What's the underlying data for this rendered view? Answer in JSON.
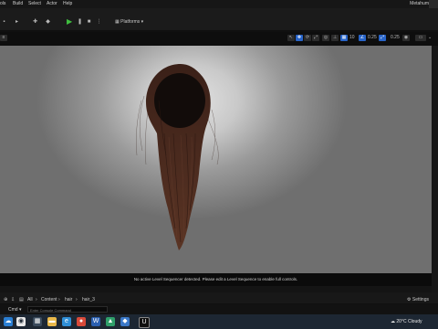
{
  "menu": [
    "ols",
    "Build",
    "Select",
    "Actor",
    "Help"
  ],
  "title_right": "Metahum",
  "toolbar": {
    "platforms_label": "Platforms",
    "play_icon": "play-icon"
  },
  "viewport_bar": {
    "grid_value": "10",
    "angle_value": "0.25"
  },
  "viewport_message": "No active Level Sequencer detected. Please edit a Level Sequence to enable full controls.",
  "content_browser": {
    "breadcrumb": [
      "All",
      "Content",
      "hair",
      "hair_3"
    ],
    "settings_label": "Settings"
  },
  "cmd": {
    "label": "Cmd",
    "placeholder": "Enter Console Command"
  },
  "taskbar": {
    "weather": "20°C  Cloudy"
  },
  "colors": {
    "accent": "#2864c8",
    "play": "#3fbf3f",
    "hair": "#4a2a1e"
  }
}
